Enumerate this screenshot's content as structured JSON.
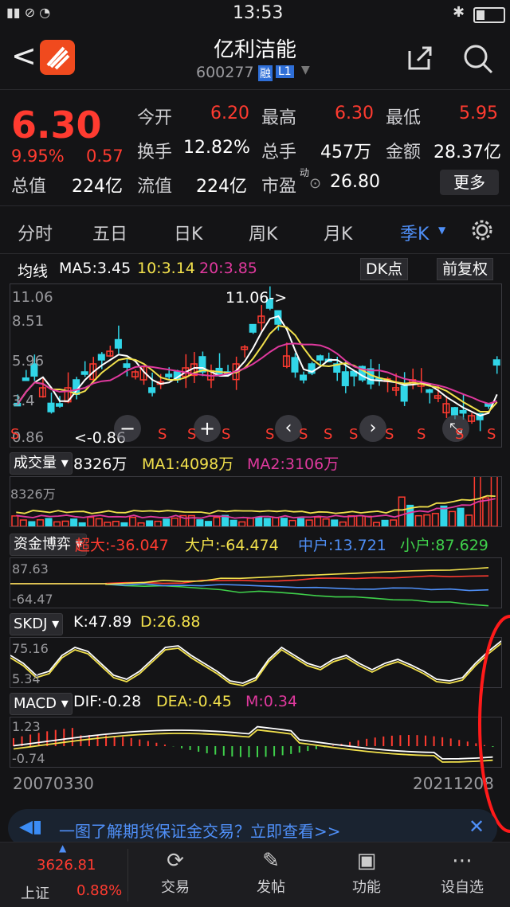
{
  "status": {
    "time": "13:53"
  },
  "header": {
    "title": "亿利洁能",
    "code": "600277",
    "badge_rong": "融",
    "badge_level": "L1"
  },
  "quote": {
    "price": "6.30",
    "change_pct": "9.95%",
    "change": "0.57",
    "open_label": "今开",
    "open": "6.20",
    "high_label": "最高",
    "high": "6.30",
    "low_label": "最低",
    "low": "5.95",
    "turnover_label": "换手",
    "turnover": "12.82%",
    "volume_label": "总手",
    "volume": "457万",
    "amount_label": "金额",
    "amount": "28.37亿",
    "mktcap_label": "总值",
    "mktcap": "224亿",
    "float_label": "流值",
    "float_cap": "224亿",
    "pe_label": "市盈",
    "pe_sup": "动",
    "pe": "26.80",
    "more": "更多"
  },
  "tabs": [
    "分时",
    "五日",
    "日K",
    "周K",
    "月K",
    "季K"
  ],
  "ma": {
    "label": "均线",
    "ma5": "MA5:3.45",
    "ma10": "10:3.14",
    "ma20": "20:3.85",
    "dk": "DK点",
    "fq": "前复权"
  },
  "kline": {
    "axis_top": "11.06",
    "axis_2": "8.51",
    "axis_3": "5.96",
    "axis_4": "3.4",
    "axis_bottom": "0.86",
    "hi_note": "11.06->",
    "lo_note": "<-0.86",
    "s": "S"
  },
  "volume": {
    "btn": "成交量",
    "vol": "8326万",
    "ma1": "MA1:4098万",
    "ma2": "MA2:3106万",
    "axis": "8326万"
  },
  "fund": {
    "btn": "资金博弈",
    "chaoda": "超大:-36.047",
    "dahu": "大户:-64.474",
    "zhonghu": "中户:13.721",
    "xiaohu": "小户:87.629",
    "axis_top": "87.63",
    "axis_bottom": "-64.47"
  },
  "skdj": {
    "btn": "SKDJ",
    "k": "K:47.89",
    "d": "D:26.88",
    "axis_top": "75.16",
    "axis_bottom": "5.34"
  },
  "macd": {
    "btn": "MACD",
    "dif": "DIF:-0.28",
    "dea": "DEA:-0.45",
    "m": "M:0.34",
    "axis_top": "1.23",
    "axis_bottom": "-0.74"
  },
  "dates": {
    "start": "20070330",
    "end": "20211208"
  },
  "banner": {
    "text": "一图了解期货保证金交易？立即查看>>"
  },
  "bottom": {
    "index_value": "3626.81",
    "index_name": "上证",
    "index_pct": "0.88%",
    "nav": [
      "交易",
      "发帖",
      "功能",
      "设自选"
    ]
  },
  "colors": {
    "up": "#ff3b30",
    "down": "#31d6e8",
    "ma5": "#ffffff",
    "ma10": "#f2e14c",
    "ma20": "#e0399e",
    "accent": "#4f8ff7"
  }
}
